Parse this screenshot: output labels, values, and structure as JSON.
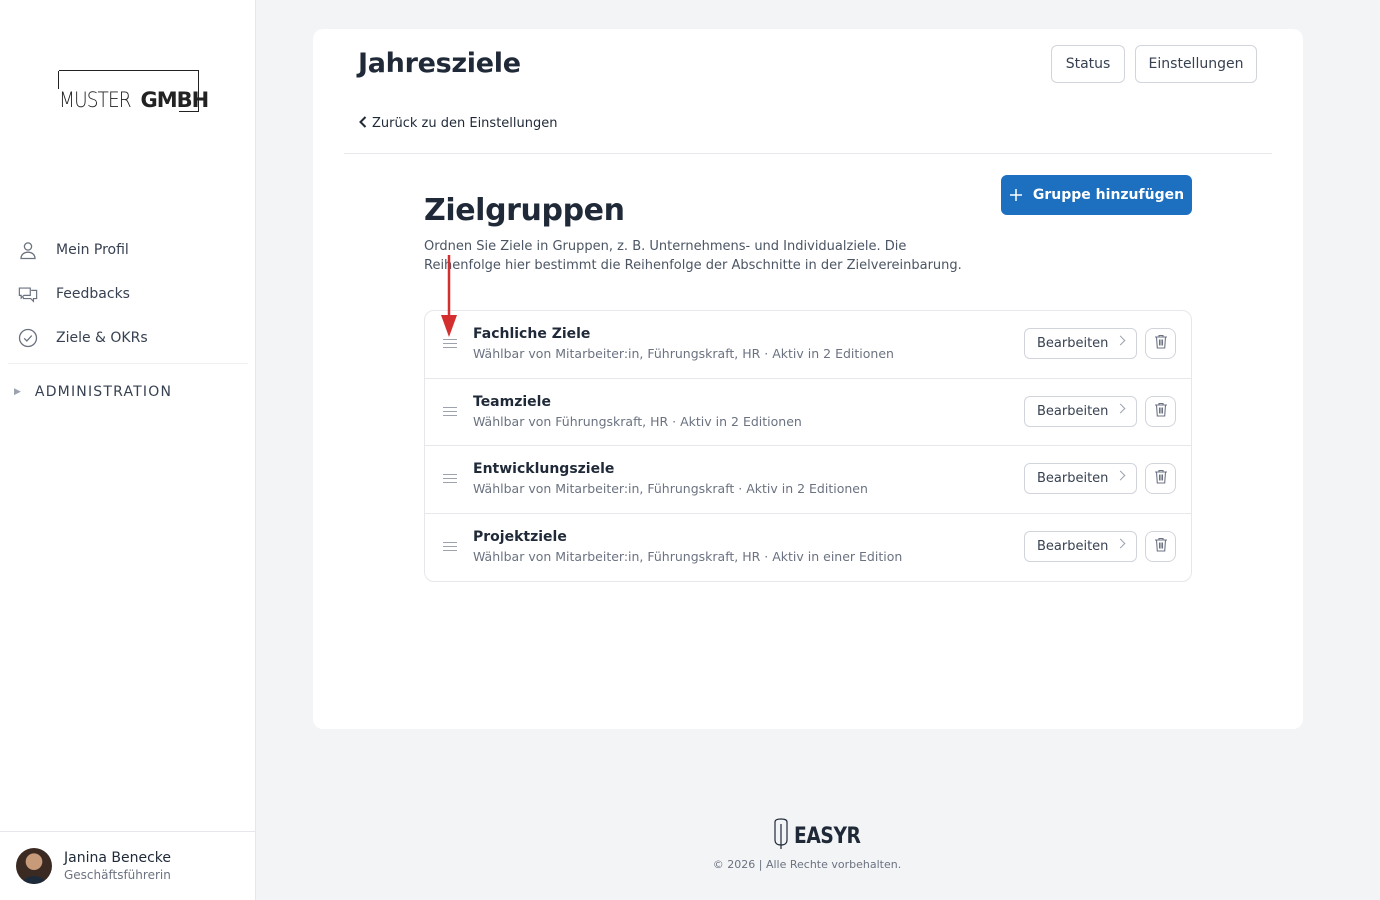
{
  "brand": {
    "logo_light": "MUSTER",
    "logo_bold": "GMBH"
  },
  "sidebar": {
    "items": [
      {
        "label": "Mein Profil",
        "icon": "user-icon"
      },
      {
        "label": "Feedbacks",
        "icon": "chat-icon"
      },
      {
        "label": "Ziele & OKRs",
        "icon": "check-circle-icon"
      }
    ],
    "admin_label": "ADMINISTRATION"
  },
  "user": {
    "name": "Janina Benecke",
    "role": "Geschäftsführerin"
  },
  "header": {
    "title": "Jahresziele",
    "status_label": "Status",
    "settings_label": "Einstellungen",
    "back_label": "Zurück zu den Einstellungen"
  },
  "section": {
    "title": "Zielgruppen",
    "description": "Ordnen Sie Ziele in Gruppen, z. B. Unternehmens- und Individualziele. Die Reihenfolge hier bestimmt die Reihenfolge der Abschnitte in der Zielvereinbarung.",
    "add_label": "Gruppe hinzufügen"
  },
  "groups": [
    {
      "name": "Fachliche Ziele",
      "meta": "Wählbar von Mitarbeiter:in, Führungskraft, HR · Aktiv in 2 Editionen",
      "edit_label": "Bearbeiten"
    },
    {
      "name": "Teamziele",
      "meta": "Wählbar von Führungskraft, HR · Aktiv in 2 Editionen",
      "edit_label": "Bearbeiten"
    },
    {
      "name": "Entwicklungsziele",
      "meta": "Wählbar von Mitarbeiter:in, Führungskraft · Aktiv in 2 Editionen",
      "edit_label": "Bearbeiten"
    },
    {
      "name": "Projektziele",
      "meta": "Wählbar von Mitarbeiter:in, Führungskraft, HR · Aktiv in einer Edition",
      "edit_label": "Bearbeiten"
    }
  ],
  "footer": {
    "logo": "EASYR",
    "copyright": "© 2026 | Alle Rechte vorbehalten."
  },
  "colors": {
    "primary": "#1d6fbf",
    "annotation": "#d32f2f"
  }
}
